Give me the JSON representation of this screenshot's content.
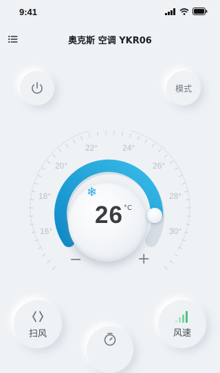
{
  "status": {
    "time": "9:41"
  },
  "header": {
    "title": "奥克斯 空调 YKR06",
    "menu_icon": "menu-icon"
  },
  "controls": {
    "power_icon": "power-icon",
    "mode_label": "模式",
    "swing_label": "扫风",
    "speed_label": "风速",
    "timer_icon": "timer-icon"
  },
  "dial": {
    "scale": [
      "16°",
      "18°",
      "20°",
      "22°",
      "24°",
      "26°",
      "28°",
      "30°"
    ],
    "temperature": "26",
    "unit": "°C",
    "mode_icon": "snowflake-icon",
    "minus": "−",
    "plus": "+",
    "accent": "#1fa6dc"
  }
}
